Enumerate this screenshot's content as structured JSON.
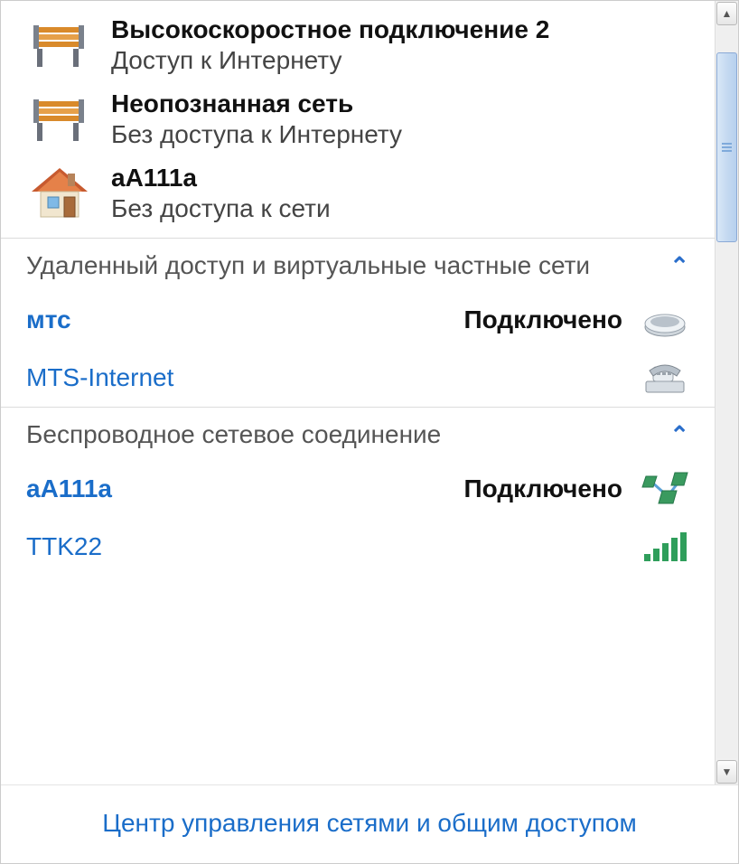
{
  "networks": [
    {
      "icon": "bench",
      "title": "Высокоскоростное подключение  2",
      "sub": "Доступ к Интернету"
    },
    {
      "icon": "bench",
      "title": "Неопознанная сеть",
      "sub": "Без доступа к Интернету"
    },
    {
      "icon": "house",
      "title": "aA111a",
      "sub": "Без доступа к сети"
    }
  ],
  "groups": [
    {
      "header": "Удаленный доступ и виртуальные частные сети",
      "items": [
        {
          "name": "мтс",
          "bold": true,
          "status": "Подключено",
          "icon": "modem"
        },
        {
          "name": "MTS-Internet",
          "bold": false,
          "status": "",
          "icon": "phone"
        }
      ]
    },
    {
      "header": "Беспроводное сетевое соединение",
      "items": [
        {
          "name": "aA111a",
          "bold": true,
          "status": "Подключено",
          "icon": "net-nodes"
        },
        {
          "name": "TTK22",
          "bold": false,
          "status": "",
          "icon": "signal"
        }
      ]
    }
  ],
  "footer_link": "Центр управления сетями и общим доступом"
}
